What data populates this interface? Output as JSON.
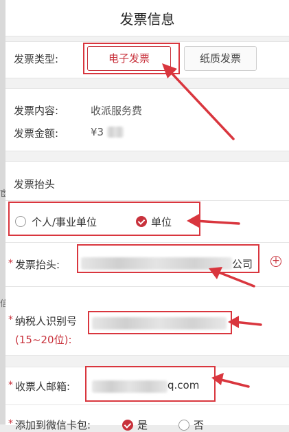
{
  "header": {
    "title": "发票信息"
  },
  "invoice_type": {
    "label": "发票类型:",
    "options": [
      {
        "label": "电子发票",
        "selected": true
      },
      {
        "label": "纸质发票",
        "selected": false
      }
    ]
  },
  "invoice_info": {
    "content_label": "发票内容:",
    "content_value": "收派服务费",
    "amount_label": "发票金额:",
    "amount_value": "¥3"
  },
  "invoice_title": {
    "heading": "发票抬头",
    "radio_personal": "个人/事业单位",
    "radio_company": "单位",
    "selected": "单位",
    "title_label": "发票抬头:",
    "title_value_visible": "公司",
    "taxid_label": "纳税人识别号",
    "taxid_hint": "(15~20位):",
    "email_label": "收票人邮箱:",
    "email_value_visible": "q.com",
    "wechat_label": "添加到微信卡包:",
    "wechat_yes": "是",
    "wechat_no": "否"
  },
  "required_mark": "*",
  "left_strip": {
    "frag1": "宦",
    "frag2": "信"
  },
  "colors": {
    "accent": "#c8323c",
    "annotation": "#d9363e",
    "background": "#f2f2f2"
  }
}
